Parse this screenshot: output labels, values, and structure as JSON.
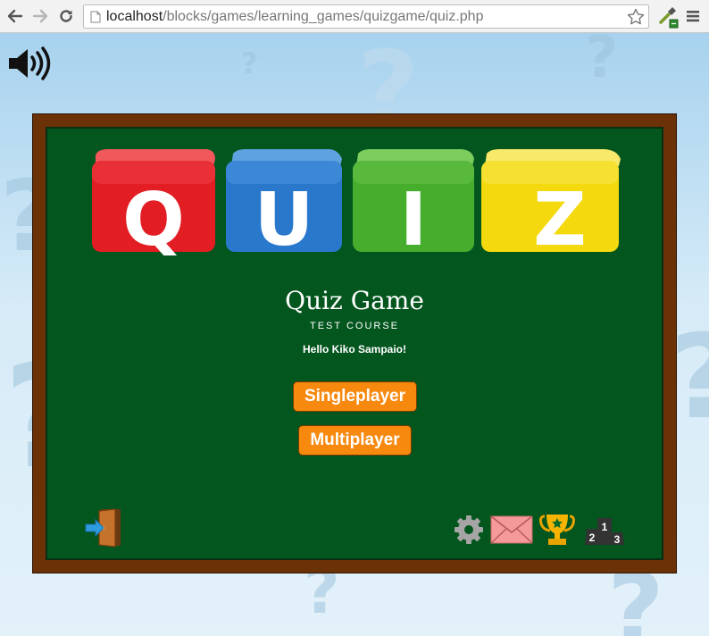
{
  "browser": {
    "url_host": "localhost",
    "url_path": "/blocks/games/learning_games/quizgame/quiz.php",
    "back_icon": "arrow-left-icon",
    "forward_icon": "arrow-right-icon",
    "reload_icon": "reload-icon",
    "page_icon": "document-icon",
    "star_icon": "star-icon",
    "extension_icon": "eyedropper-icon",
    "menu_icon": "hamburger-menu-icon"
  },
  "sound_icon": "speaker-icon",
  "board": {
    "logo_letters": [
      "Q",
      "U",
      "I",
      "Z"
    ],
    "logo_colors": [
      "#e21d24",
      "#2a78cc",
      "#47ad2c",
      "#f3d90e"
    ],
    "title": "Quiz Game",
    "course": "TEST COURSE",
    "greeting": "Hello Kiko Sampaio!",
    "buttons": {
      "singleplayer": "Singleplayer",
      "multiplayer": "Multiplayer"
    },
    "footer_icons": [
      "exit-door-icon",
      "settings-gear-icon",
      "mail-envelope-icon",
      "trophy-icon",
      "podium-ranking-icon"
    ],
    "podium_numbers": [
      "2",
      "1",
      "3"
    ]
  },
  "colors": {
    "board_frame": "#6b3208",
    "board_green": "#04561f",
    "button_orange": "#f7890f"
  }
}
